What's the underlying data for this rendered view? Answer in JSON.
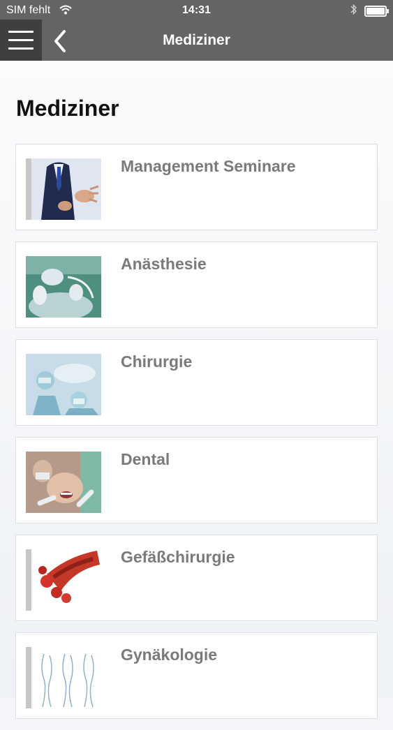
{
  "status": {
    "carrier": "SIM fehlt",
    "time": "14:31"
  },
  "nav": {
    "title": "Mediziner",
    "menu_icon": "hamburger-menu-icon",
    "back_icon": "chevron-left-icon"
  },
  "page": {
    "heading": "Mediziner"
  },
  "items": [
    {
      "label": "Management Seminare",
      "image": "business-presentation-photo"
    },
    {
      "label": "Anästhesie",
      "image": "anesthesia-photo"
    },
    {
      "label": "Chirurgie",
      "image": "surgery-team-photo"
    },
    {
      "label": "Dental",
      "image": "dental-treatment-photo"
    },
    {
      "label": "Gefäßchirurgie",
      "image": "blood-vessel-illustration"
    },
    {
      "label": "Gynäkologie",
      "image": "female-figures-sketch"
    }
  ]
}
